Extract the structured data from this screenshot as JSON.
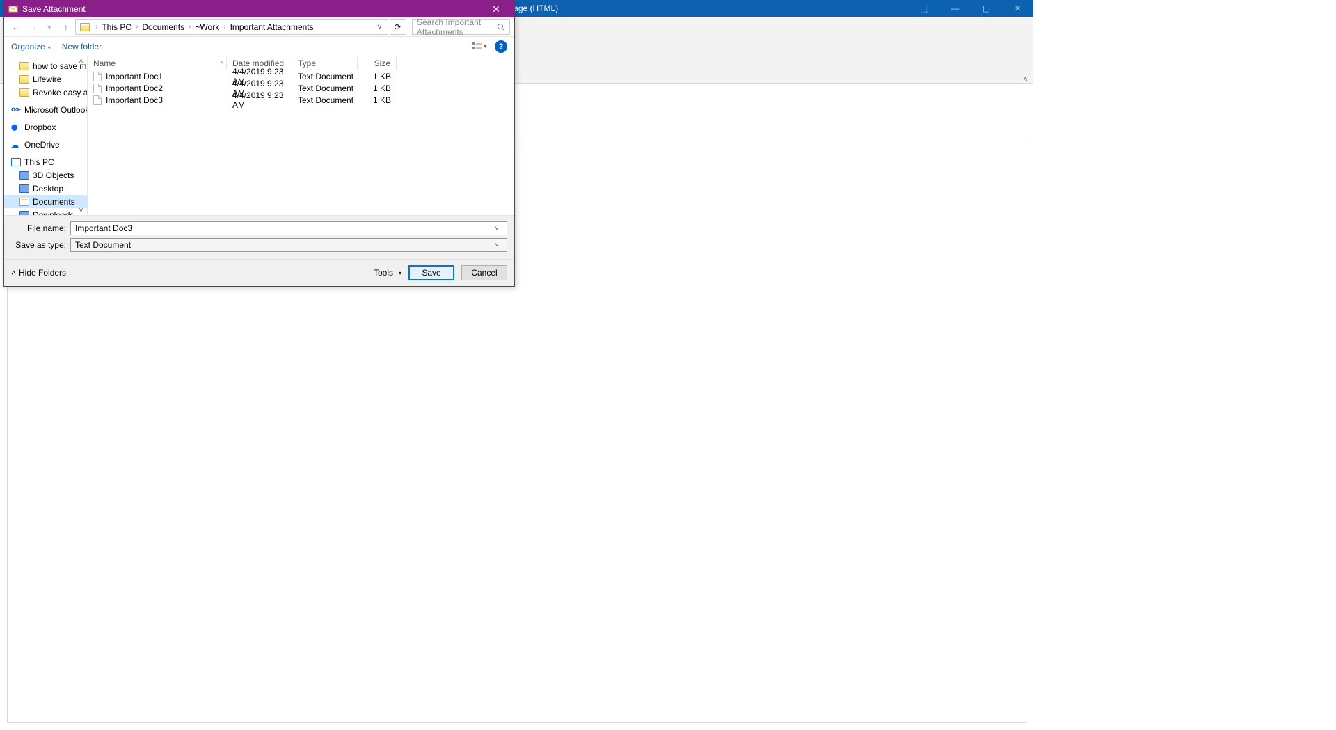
{
  "outlook": {
    "title_suffix": "nts - Message (HTML)",
    "sysbtn": {
      "popout": "⬚",
      "min": "—",
      "max": "▢",
      "close": "✕"
    },
    "collapse": "˄"
  },
  "dialog": {
    "title": "Save Attachment",
    "close": "✕",
    "nav": {
      "back": "←",
      "forward": "→",
      "recent": "▾",
      "up": "↑"
    },
    "breadcrumb": [
      "This PC",
      "Documents",
      "~Work",
      "Important Attachments"
    ],
    "bc_sep": "›",
    "bc_drop": "˅",
    "refresh": "⟳",
    "search_placeholder": "Search Important Attachments",
    "search_icon": "🔍",
    "toolbar": {
      "organize": "Organize",
      "newfolder": "New folder",
      "view_drop": "▾",
      "help": "?"
    },
    "tree_arrow_up": "˄",
    "tree_arrow_dn": "˅",
    "tree": [
      {
        "label": "how to save mul",
        "icon": "folder",
        "indent": true
      },
      {
        "label": "Lifewire",
        "icon": "folder",
        "indent": true
      },
      {
        "label": "Revoke easy acc",
        "icon": "folder",
        "indent": true
      },
      {
        "label": "Microsoft Outlook",
        "icon": "outlook",
        "indent": false
      },
      {
        "label": "Dropbox",
        "icon": "dropbox",
        "indent": false
      },
      {
        "label": "OneDrive",
        "icon": "onedrive",
        "indent": false
      },
      {
        "label": "This PC",
        "icon": "pc",
        "indent": false
      },
      {
        "label": "3D Objects",
        "icon": "blue",
        "indent": true
      },
      {
        "label": "Desktop",
        "icon": "blue",
        "indent": true
      },
      {
        "label": "Documents",
        "icon": "docs",
        "indent": true,
        "selected": true
      },
      {
        "label": "Downloads",
        "icon": "blue",
        "indent": true
      }
    ],
    "columns": {
      "name": "Name",
      "date": "Date modified",
      "type": "Type",
      "size": "Size"
    },
    "files": [
      {
        "name": "Important Doc1",
        "date": "4/4/2019 9:23 AM",
        "type": "Text Document",
        "size": "1 KB"
      },
      {
        "name": "Important Doc2",
        "date": "4/4/2019 9:23 AM",
        "type": "Text Document",
        "size": "1 KB"
      },
      {
        "name": "Important Doc3",
        "date": "4/4/2019 9:23 AM",
        "type": "Text Document",
        "size": "1 KB"
      }
    ],
    "filename_label": "File name:",
    "filename_value": "Important Doc3",
    "saveas_label": "Save as type:",
    "saveas_value": "Text Document",
    "hide_folders": "Hide Folders",
    "hide_arrow": "˄",
    "tools": "Tools",
    "tools_drop": "▾",
    "save": "Save",
    "cancel": "Cancel"
  }
}
